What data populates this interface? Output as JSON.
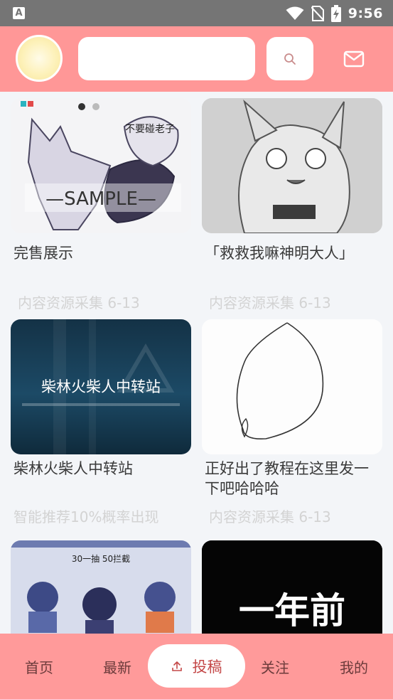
{
  "status_bar": {
    "time": "9:56",
    "app_icon_letter": "A"
  },
  "header": {
    "search": {
      "value": "",
      "placeholder": ""
    }
  },
  "feed": [
    {
      "title": "完售展示",
      "source": "内容资源采集 6-13",
      "thumb_text": "—SAMPLE—",
      "thumb_caption": "不要碰老子"
    },
    {
      "title": "「救救我嘛神明大人」",
      "source": "内容资源采集 6-13"
    },
    {
      "title": "柴林火柴人中转站",
      "source": "智能推荐10%概率出现",
      "thumb_text": "柴林火柴人中转站"
    },
    {
      "title": "正好出了教程在这里发一下吧哈哈哈",
      "source": "内容资源采集 6-13"
    },
    {
      "title": "",
      "source": "",
      "thumb_text": "30一抽 50拦截"
    },
    {
      "title": "",
      "source": "",
      "thumb_text": "一年前"
    }
  ],
  "bottom_nav": {
    "home": "首页",
    "latest": "最新",
    "post": "投稿",
    "follow": "关注",
    "mine": "我的"
  },
  "colors": {
    "brand": "#ff9797",
    "nav_text": "#6b3b3b",
    "post_accent": "#c44848"
  }
}
